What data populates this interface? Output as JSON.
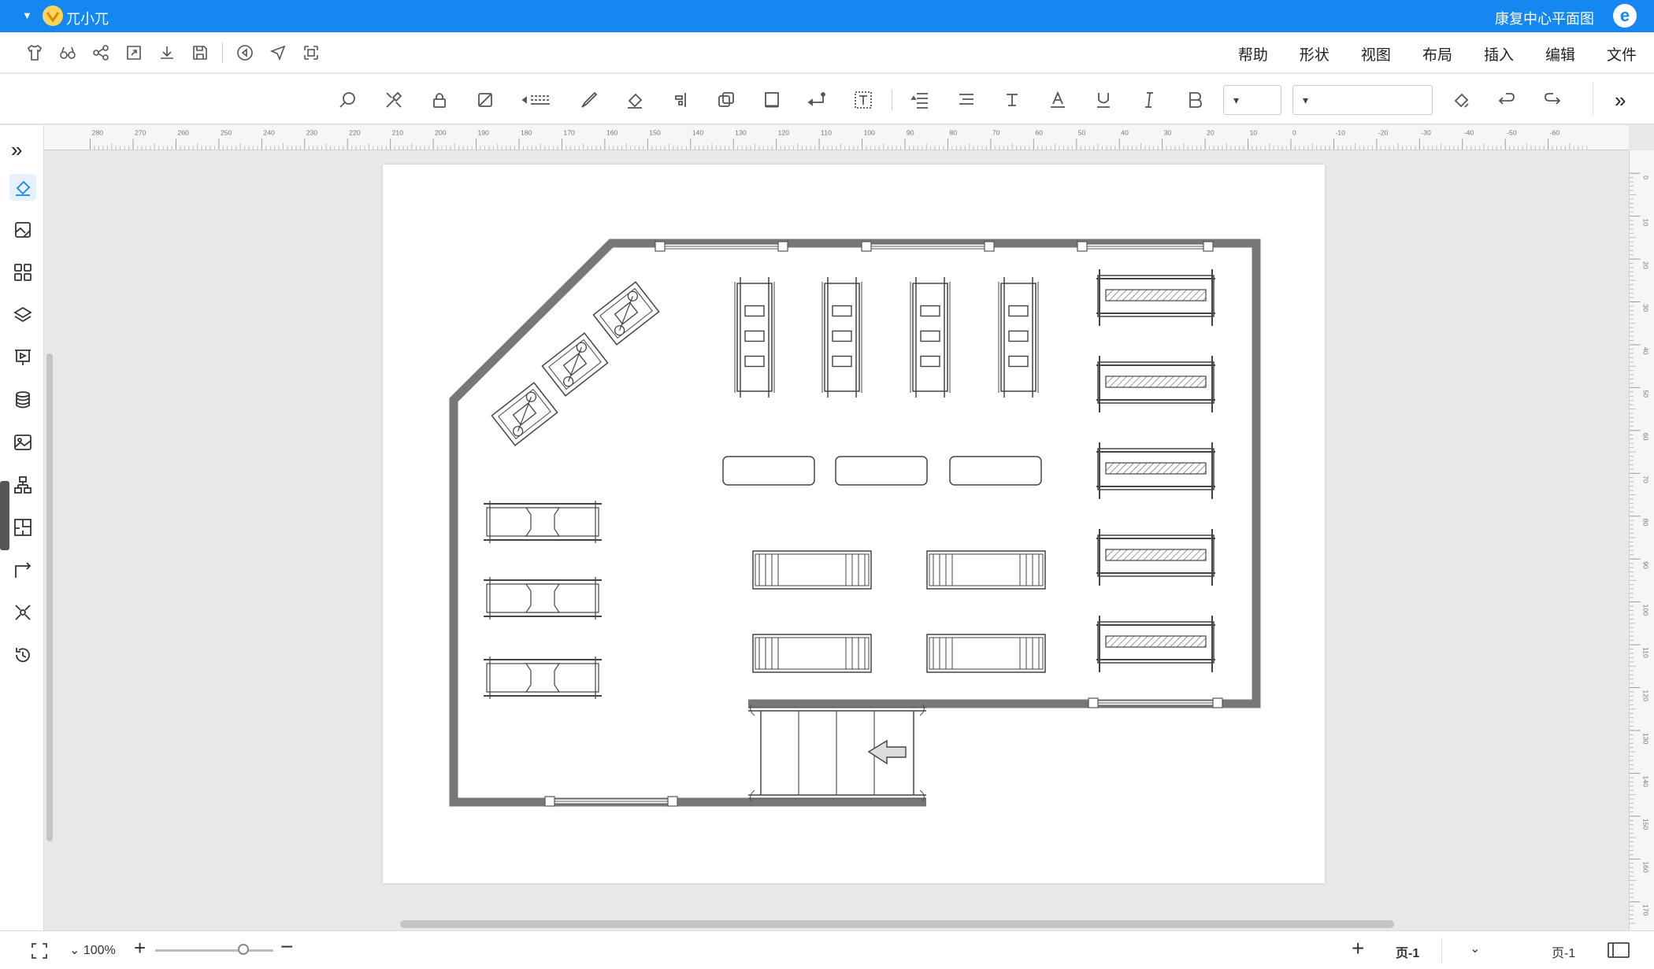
{
  "titlebar": {
    "doc_title": "康复中心平面图",
    "user_name": "兀小兀",
    "logo_glyph": "e",
    "bg_color": "#1487f0"
  },
  "menu": {
    "items": [
      "文件",
      "编辑",
      "插入",
      "布局",
      "视图",
      "形状",
      "帮助"
    ]
  },
  "quick_tools": [
    "shirt-icon",
    "binoculars-icon",
    "share-icon",
    "export-icon",
    "download-icon",
    "save-icon",
    "play-icon",
    "pointer-icon",
    "crop-icon"
  ],
  "format_toolbar": {
    "tools": [
      "search-icon",
      "tools-icon",
      "lock-icon",
      "crop-image-icon",
      "line-style-icon",
      "pen-icon",
      "fill-icon",
      "align-icon",
      "duplicate-icon",
      "frame-icon",
      "connector-icon",
      "textbox-icon",
      "line-spacing-icon",
      "align-text-icon",
      "text-strike-icon",
      "font-color-icon",
      "underline-icon",
      "italic-icon",
      "bold-icon"
    ],
    "font_size_value": "",
    "font_family_value": "",
    "accent": "#1487f0"
  },
  "ruler": {
    "h_labels": [
      "280",
      "270",
      "260",
      "250",
      "240",
      "230",
      "220",
      "210",
      "200",
      "190",
      "180",
      "170",
      "160",
      "150",
      "140",
      "130",
      "120",
      "110",
      "100",
      "90",
      "80",
      "70",
      "60",
      "50",
      "40",
      "30",
      "20",
      "10",
      "0",
      "-10",
      "-20",
      "-30",
      "-40",
      "-50",
      "-60"
    ],
    "v_labels": [
      "0",
      "10",
      "20",
      "30",
      "40",
      "50",
      "60",
      "70",
      "80",
      "90",
      "100",
      "110",
      "120",
      "130",
      "140",
      "150",
      "160",
      "170"
    ]
  },
  "sidebar": {
    "items": [
      "fill-brush-icon",
      "image-frame-icon",
      "grid-icon",
      "layers-icon",
      "presentation-icon",
      "database-icon",
      "image-icon",
      "org-chart-icon",
      "floorplan-icon",
      "connector-icon",
      "network-icon",
      "history-icon"
    ]
  },
  "statusbar": {
    "zoom_label": "100%",
    "zoom_level_percent": 100,
    "page_tab": "页-1",
    "page_name": "页-1",
    "add_page": "+",
    "zoom_plus": "+",
    "zoom_minus": "−"
  }
}
